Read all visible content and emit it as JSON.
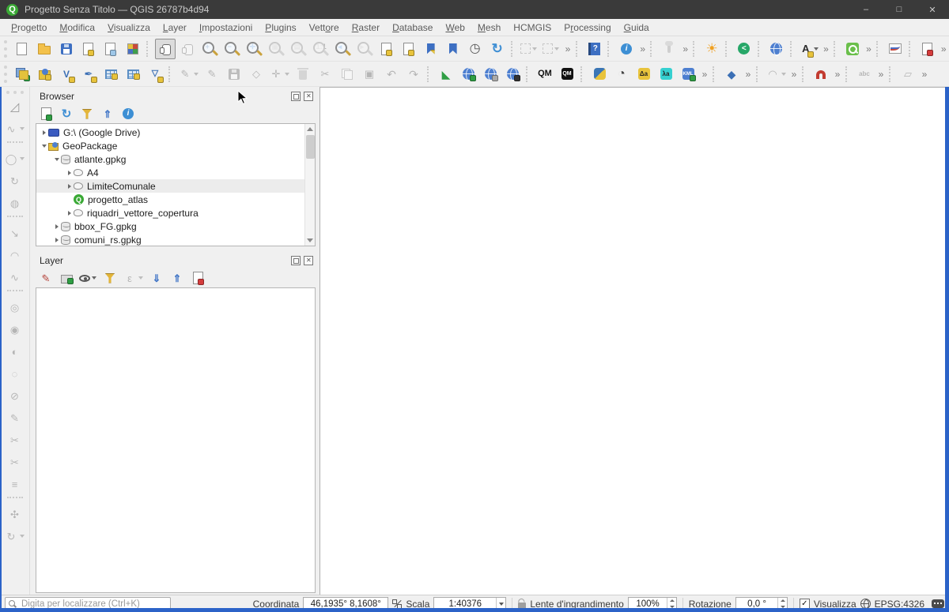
{
  "window": {
    "title": "Progetto Senza Titolo — QGIS 26787b4d94",
    "accent_color": "#2c63c8",
    "controls": {
      "minimize": "–",
      "maximize": "□",
      "close": "✕"
    }
  },
  "menu": {
    "items": [
      {
        "label": "Progetto",
        "u": 0
      },
      {
        "label": "Modifica",
        "u": 0
      },
      {
        "label": "Visualizza",
        "u": 0
      },
      {
        "label": "Layer",
        "u": 0
      },
      {
        "label": "Impostazioni",
        "u": 0
      },
      {
        "label": "Plugins",
        "u": 0
      },
      {
        "label": "Vettore",
        "u": 4
      },
      {
        "label": "Raster",
        "u": 0
      },
      {
        "label": "Database",
        "u": 0
      },
      {
        "label": "Web",
        "u": 0
      },
      {
        "label": "Mesh",
        "u": 0
      },
      {
        "label": "HCMGIS",
        "u": -1
      },
      {
        "label": "Processing",
        "u": 1
      },
      {
        "label": "Guida",
        "u": 0
      }
    ]
  },
  "toolbars": {
    "row1": [
      {
        "t": "h"
      },
      {
        "name": "new-project",
        "shape": "page"
      },
      {
        "name": "open-project",
        "shape": "folder"
      },
      {
        "name": "save-project",
        "shape": "floppy"
      },
      {
        "name": "new-print-layout",
        "shape": "page",
        "badge": "#e8c33c"
      },
      {
        "name": "show-layout-manager",
        "shape": "page",
        "badge": "#9ec7e8"
      },
      {
        "name": "style-manager",
        "shape": "palette"
      },
      {
        "t": "s"
      },
      {
        "name": "pan-map",
        "shape": "hand",
        "pressed": true
      },
      {
        "name": "pan-to-selection",
        "shape": "hand",
        "disabled": true
      },
      {
        "name": "zoom-in",
        "shape": "mag",
        "glyph": "+",
        "color": "#1f4e8c"
      },
      {
        "name": "zoom-out",
        "shape": "mag",
        "glyph": "−",
        "color": "#1f4e8c"
      },
      {
        "name": "zoom-full-extent",
        "shape": "mag",
        "glyph": "✛",
        "color": "#2a72c8"
      },
      {
        "name": "zoom-to-selection",
        "shape": "mag",
        "glyph": "▣",
        "disabled": true
      },
      {
        "name": "zoom-to-layer",
        "shape": "mag",
        "glyph": "▤",
        "disabled": true
      },
      {
        "name": "zoom-native-resolution",
        "shape": "mag",
        "glyph": "1:1",
        "disabled": true
      },
      {
        "name": "zoom-last",
        "shape": "mag",
        "glyph": "◂",
        "color": "#2a72c8"
      },
      {
        "name": "zoom-next",
        "shape": "mag",
        "glyph": "▸",
        "disabled": true
      },
      {
        "name": "new-map-view",
        "shape": "page",
        "badge": "#e8c33c"
      },
      {
        "name": "new-3d-map-view",
        "shape": "page",
        "badge": "#e8c33c"
      },
      {
        "name": "new-spatial-bookmark",
        "shape": "bookmark",
        "badge": "#e8c33c"
      },
      {
        "name": "show-spatial-bookmarks",
        "shape": "bookmark"
      },
      {
        "name": "temporal-controller",
        "glyph": "◷",
        "color": "#555",
        "size": 16
      },
      {
        "name": "refresh-map",
        "glyph": "↻",
        "color": "#3f8fd4",
        "size": 17,
        "bold": true
      },
      {
        "t": "s"
      },
      {
        "name": "select-features",
        "shape": "dashedsq",
        "disabled": true,
        "dd": true
      },
      {
        "name": "deselect-features",
        "shape": "dashedsq",
        "disabled": true,
        "dd": true
      },
      {
        "t": "m"
      },
      {
        "t": "s"
      },
      {
        "name": "help-contents",
        "shape": "book",
        "glyph": "?"
      },
      {
        "t": "s"
      },
      {
        "name": "identify-features",
        "shape": "infoc",
        "glyph": "i"
      },
      {
        "t": "m"
      },
      {
        "t": "s"
      },
      {
        "name": "pin-labels",
        "shape": "pin",
        "disabled": true
      },
      {
        "t": "m"
      },
      {
        "t": "s"
      },
      {
        "name": "sun-calc-plugin",
        "glyph": "☀",
        "color": "#f0a020",
        "size": 17
      },
      {
        "t": "s"
      },
      {
        "name": "share-plugin",
        "shape": "circle",
        "bg": "#27a768",
        "glyph": "<",
        "color": "#ffffff",
        "bold": true,
        "size": 10
      },
      {
        "t": "s"
      },
      {
        "name": "web-maps-plugin",
        "shape": "globe"
      },
      {
        "t": "s"
      },
      {
        "name": "auto-translate-plugin",
        "glyph": "A",
        "color": "#2b2b2b",
        "bold": true,
        "size": 13,
        "badge": "#e8c33c",
        "dd": true
      },
      {
        "t": "m"
      },
      {
        "t": "s"
      },
      {
        "name": "search-layers-plugin",
        "shape": "sqmag",
        "bg": "#6abf4b"
      },
      {
        "t": "m"
      },
      {
        "t": "s"
      },
      {
        "name": "data-plot-plugin",
        "shape": "chart"
      },
      {
        "t": "s"
      },
      {
        "name": "report-plugin",
        "shape": "page",
        "badge": "#d43c3c"
      },
      {
        "t": "m"
      }
    ],
    "row2": [
      {
        "t": "h"
      },
      {
        "name": "data-source-manager",
        "shape": "stack",
        "badge": "#2f9e44"
      },
      {
        "name": "new-geopackage-layer",
        "shape": "gpkgbox",
        "badge": "#e8c33c"
      },
      {
        "name": "new-shapefile-layer",
        "glyph": "V",
        "color": "#3b6fb5",
        "bold": true,
        "size": 12,
        "badge": "#e8c33c"
      },
      {
        "name": "new-spatialite-layer",
        "glyph": "✒",
        "color": "#3b6fb5",
        "size": 13,
        "badge": "#e8c33c"
      },
      {
        "name": "new-temporary-scratch-layer",
        "shape": "grid",
        "badge": "#e8c33c"
      },
      {
        "name": "new-virtual-layer",
        "shape": "grid",
        "badge": "#e8c33c"
      },
      {
        "name": "new-mesh-layer",
        "glyph": "▽",
        "color": "#3b6fb5",
        "bold": true,
        "size": 11,
        "badge": "#e8c33c"
      },
      {
        "t": "s"
      },
      {
        "name": "current-edits",
        "glyph": "✎",
        "disabled": true,
        "dd": true
      },
      {
        "name": "toggle-editing",
        "glyph": "✎",
        "disabled": true
      },
      {
        "name": "save-layer-edits",
        "shape": "floppy",
        "disabled": true
      },
      {
        "name": "add-feature",
        "glyph": "◇",
        "disabled": true
      },
      {
        "name": "move-feature",
        "glyph": "✛",
        "disabled": true,
        "dd": true
      },
      {
        "name": "delete-selected",
        "shape": "trash",
        "disabled": true
      },
      {
        "name": "cut-features",
        "glyph": "✂",
        "disabled": true,
        "size": 13
      },
      {
        "name": "copy-features",
        "shape": "copy",
        "disabled": true
      },
      {
        "name": "paste-features",
        "glyph": "▣",
        "disabled": true,
        "size": 13
      },
      {
        "name": "undo",
        "glyph": "↶",
        "disabled": true,
        "size": 14
      },
      {
        "name": "redo",
        "glyph": "↷",
        "disabled": true,
        "size": 14
      },
      {
        "t": "s"
      },
      {
        "name": "measure-angle-plugin",
        "glyph": "◣",
        "color": "#2f9e44",
        "size": 14
      },
      {
        "name": "quickmap-add-basemap",
        "shape": "globe",
        "badge": "#2f9e44"
      },
      {
        "name": "quickmap-search",
        "shape": "globe",
        "badge": "#aaaaaa"
      },
      {
        "name": "osm-place-search",
        "shape": "globe",
        "badge": "#333333"
      },
      {
        "t": "s"
      },
      {
        "name": "qm-plugin",
        "glyph": "QM",
        "color": "#111111",
        "bold": true,
        "size": 11
      },
      {
        "name": "qm-console-plugin",
        "shape": "sq",
        "bg": "#111111",
        "glyph": "QM",
        "color": "#ffffff",
        "size": 7,
        "bold": true
      },
      {
        "t": "s"
      },
      {
        "name": "python-console",
        "shape": "python"
      },
      {
        "name": "timer-plugin",
        "glyph": "◔",
        "color": "#444444",
        "size": 16
      },
      {
        "name": "delta-attributes-plugin",
        "shape": "sq",
        "bg": "#e8c33c",
        "glyph": "Δa",
        "color": "#222222",
        "size": 8,
        "bold": true
      },
      {
        "name": "lambda-attributes-plugin",
        "shape": "sq",
        "bg": "#35d0d0",
        "glyph": "λa",
        "color": "#222222",
        "size": 8,
        "bold": true
      },
      {
        "name": "kml-tools-plugin",
        "shape": "sq",
        "bg": "#4d7fd0",
        "glyph": "KML",
        "color": "#ffffff",
        "size": 6,
        "bold": true,
        "badge": "#2f9e44"
      },
      {
        "t": "m"
      },
      {
        "t": "s"
      },
      {
        "name": "vertex-tool",
        "glyph": "◆",
        "color": "#3b6fb5",
        "size": 14
      },
      {
        "t": "m"
      },
      {
        "t": "s"
      },
      {
        "name": "digitize-with-curve",
        "glyph": "◠",
        "disabled": true,
        "dd": true
      },
      {
        "t": "m"
      },
      {
        "t": "s"
      },
      {
        "name": "snapping-toggle",
        "shape": "magnet"
      },
      {
        "t": "m"
      },
      {
        "t": "s"
      },
      {
        "name": "label-toolbar",
        "glyph": "abc",
        "disabled": true,
        "size": 8,
        "bold": true
      },
      {
        "t": "m"
      },
      {
        "t": "s"
      },
      {
        "name": "diagram-toolbar",
        "glyph": "▱",
        "disabled": true,
        "size": 13
      },
      {
        "t": "m"
      }
    ],
    "left": [
      {
        "t": "h"
      },
      {
        "name": "measure-area",
        "glyph": "◿",
        "color": "#9a9a9a",
        "size": 15
      },
      {
        "name": "digitize-with-segment",
        "glyph": "∿",
        "disabled": true,
        "dd": true
      },
      {
        "t": "s"
      },
      {
        "name": "move-feature-tool",
        "glyph": "◯",
        "disabled": true,
        "dd": true
      },
      {
        "name": "rotate-feature",
        "glyph": "↻",
        "disabled": true
      },
      {
        "name": "copy-move-feature",
        "glyph": "◍",
        "disabled": true
      },
      {
        "t": "s"
      },
      {
        "name": "scale-feature",
        "glyph": "↘",
        "disabled": true
      },
      {
        "name": "offset-curve",
        "glyph": "◠",
        "disabled": true
      },
      {
        "name": "simplify-feature",
        "glyph": "∿",
        "disabled": true
      },
      {
        "t": "s"
      },
      {
        "name": "add-ring",
        "glyph": "◎",
        "disabled": true
      },
      {
        "name": "add-part",
        "glyph": "◉",
        "disabled": true
      },
      {
        "name": "fill-ring",
        "glyph": "◐",
        "disabled": true
      },
      {
        "name": "delete-ring",
        "glyph": "◌",
        "disabled": true
      },
      {
        "name": "delete-part",
        "glyph": "⊘",
        "disabled": true
      },
      {
        "name": "reshape-features",
        "glyph": "✎",
        "disabled": true
      },
      {
        "name": "split-parts",
        "glyph": "✂",
        "disabled": true
      },
      {
        "name": "split-features",
        "glyph": "✂",
        "disabled": true
      },
      {
        "name": "merge-features",
        "glyph": "≡",
        "disabled": true
      },
      {
        "t": "s"
      },
      {
        "name": "vertex-filter",
        "glyph": "✣",
        "disabled": true
      },
      {
        "name": "rotate-point-symbols",
        "glyph": "↻",
        "disabled": true,
        "dd": true
      }
    ]
  },
  "browser": {
    "title": "Browser",
    "tools": [
      {
        "name": "add-selected-layers",
        "shape": "page",
        "badge": "#2f9e44"
      },
      {
        "name": "refresh-browser",
        "glyph": "↻",
        "color": "#3f8fd4",
        "size": 15,
        "bold": true
      },
      {
        "name": "filter-browser",
        "shape": "funnel"
      },
      {
        "name": "collapse-all",
        "glyph": "⇑",
        "color": "#3f74c6",
        "bold": true
      },
      {
        "name": "browser-properties",
        "shape": "infoc",
        "glyph": "i"
      }
    ],
    "tree": [
      {
        "indent": 0,
        "exp": "r",
        "icon": "drive",
        "label": "G:\\ (Google Drive)"
      },
      {
        "indent": 0,
        "exp": "d",
        "icon": "gpkg",
        "label": "GeoPackage"
      },
      {
        "indent": 1,
        "exp": "d",
        "icon": "db",
        "label": "atlante.gpkg"
      },
      {
        "indent": 2,
        "exp": "r",
        "icon": "poly",
        "label": "A4"
      },
      {
        "indent": 2,
        "exp": "r",
        "icon": "poly",
        "label": "LimiteComunale",
        "hl": true
      },
      {
        "indent": 2,
        "exp": "",
        "icon": "qgis",
        "label": "progetto_atlas"
      },
      {
        "indent": 2,
        "exp": "r",
        "icon": "poly",
        "label": "riquadri_vettore_copertura"
      },
      {
        "indent": 1,
        "exp": "r",
        "icon": "db",
        "label": "bbox_FG.gpkg"
      },
      {
        "indent": 1,
        "exp": "r",
        "icon": "db",
        "label": "comuni_rs.gpkg"
      }
    ]
  },
  "layers": {
    "title": "Layer",
    "tools": [
      {
        "name": "open-layer-styling",
        "glyph": "✎",
        "color": "#b5453c"
      },
      {
        "name": "add-group",
        "shape": "folderg",
        "badge": "#2f9e44"
      },
      {
        "name": "manage-map-themes",
        "shape": "eye",
        "dd": true
      },
      {
        "name": "filter-legend",
        "shape": "funnel"
      },
      {
        "name": "filter-legend-by-expression",
        "glyph": "ε",
        "disabled": true,
        "dd": true
      },
      {
        "name": "expand-all",
        "glyph": "⇓",
        "color": "#3f74c6",
        "bold": true
      },
      {
        "name": "collapse-all-layers",
        "glyph": "⇑",
        "color": "#3f74c6",
        "bold": true
      },
      {
        "name": "remove-layer",
        "shape": "page",
        "badge": "#d43c3c"
      }
    ]
  },
  "statusbar": {
    "locator_placeholder": "Digita per localizzare (Ctrl+K)",
    "coordinate_label": "Coordinata",
    "coordinate_value": "46,1935° 8,1608°",
    "scale_label": "Scala",
    "scale_value": "1:40376",
    "magnifier_label": "Lente d'ingrandimento",
    "magnifier_value": "100%",
    "rotation_label": "Rotazione",
    "rotation_value": "0,0 °",
    "render_label": "Visualizza",
    "render_checked": true,
    "crs": "EPSG:4326"
  }
}
